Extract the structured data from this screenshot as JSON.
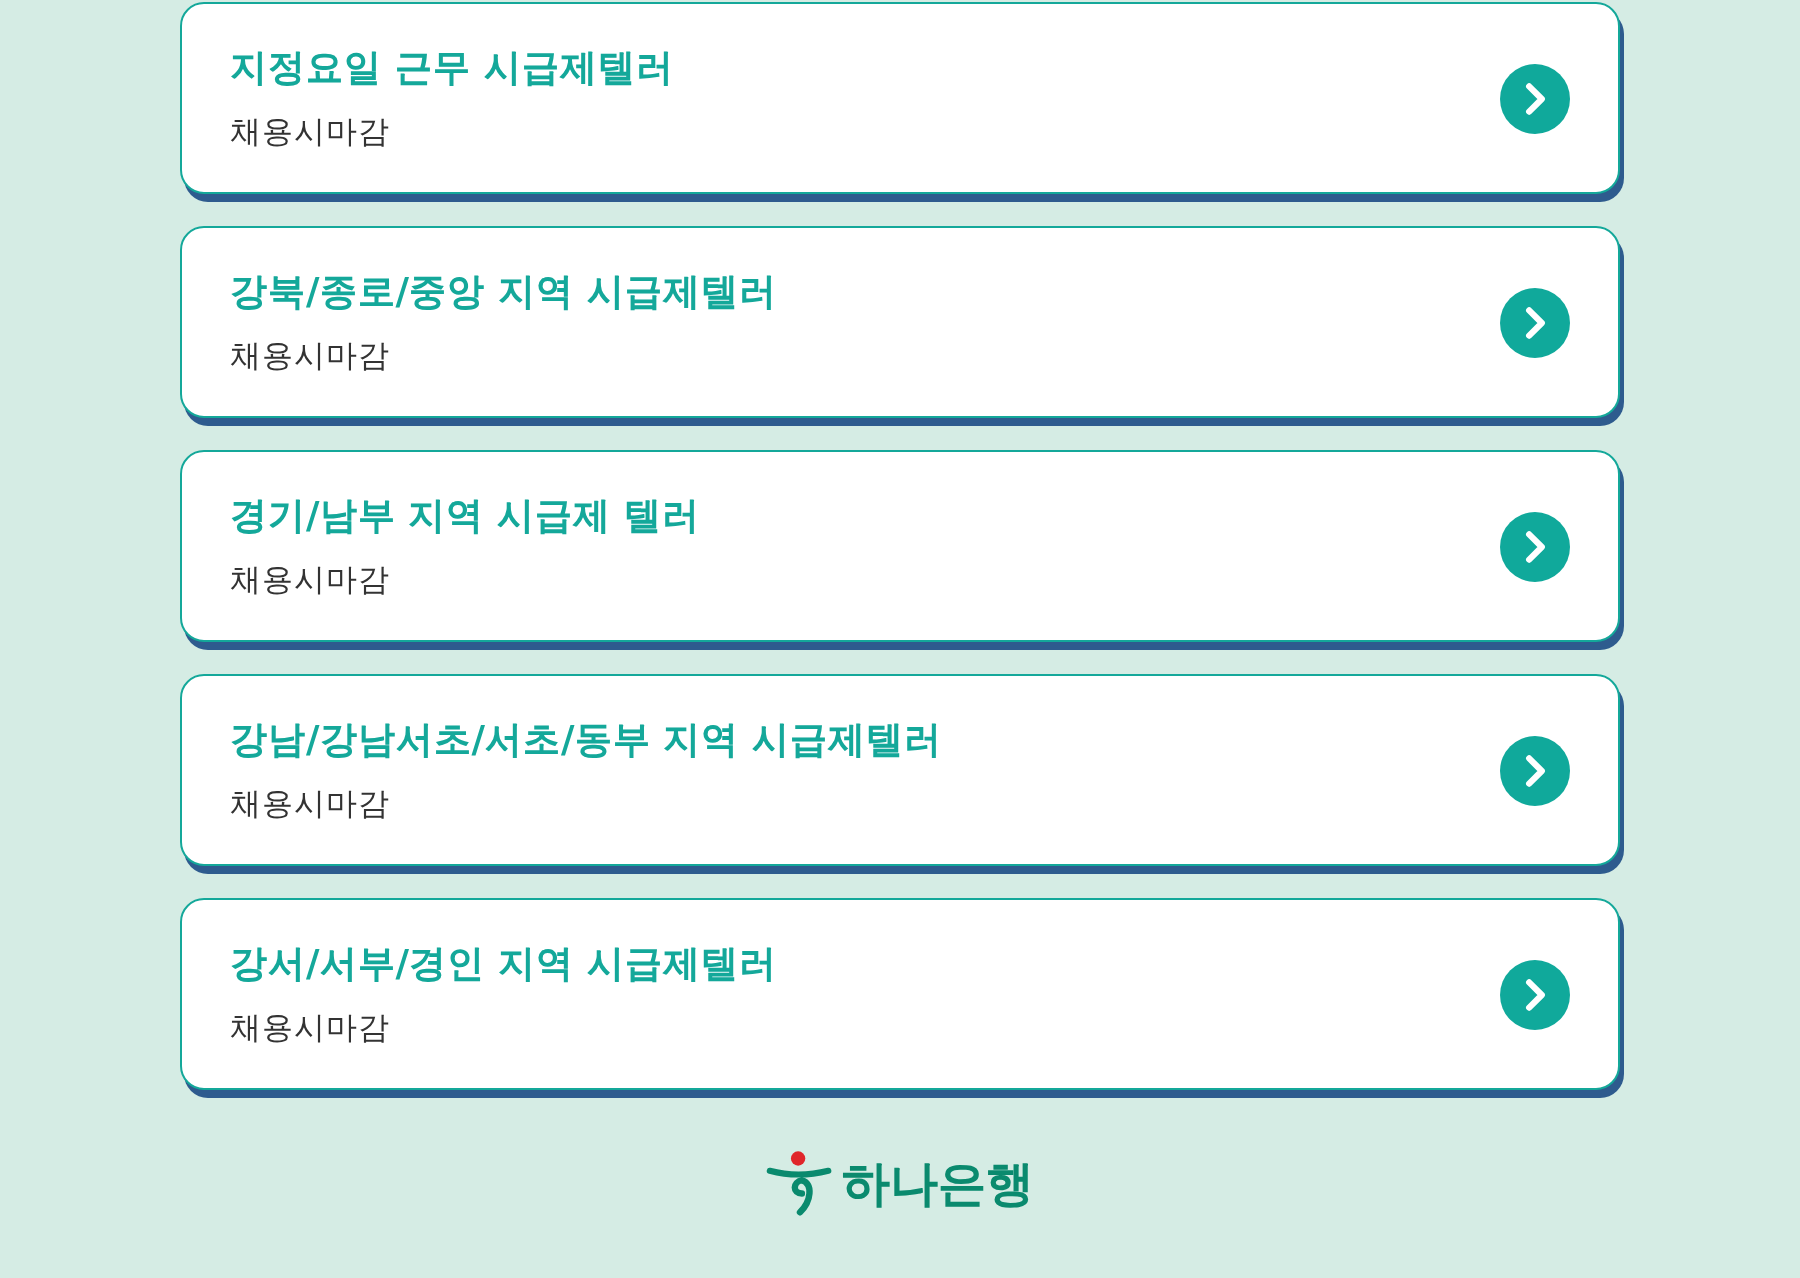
{
  "postings": [
    {
      "title": "지정요일 근무 시급제텔러",
      "status": "채용시마감"
    },
    {
      "title": "강북/종로/중앙 지역 시급제텔러",
      "status": "채용시마감"
    },
    {
      "title": "경기/남부 지역 시급제 텔러",
      "status": "채용시마감"
    },
    {
      "title": "강남/강남서초/서초/동부 지역 시급제텔러",
      "status": "채용시마감"
    },
    {
      "title": "강서/서부/경인 지역 시급제텔러",
      "status": "채용시마감"
    }
  ],
  "footer": {
    "logo_text": "하나은행"
  }
}
